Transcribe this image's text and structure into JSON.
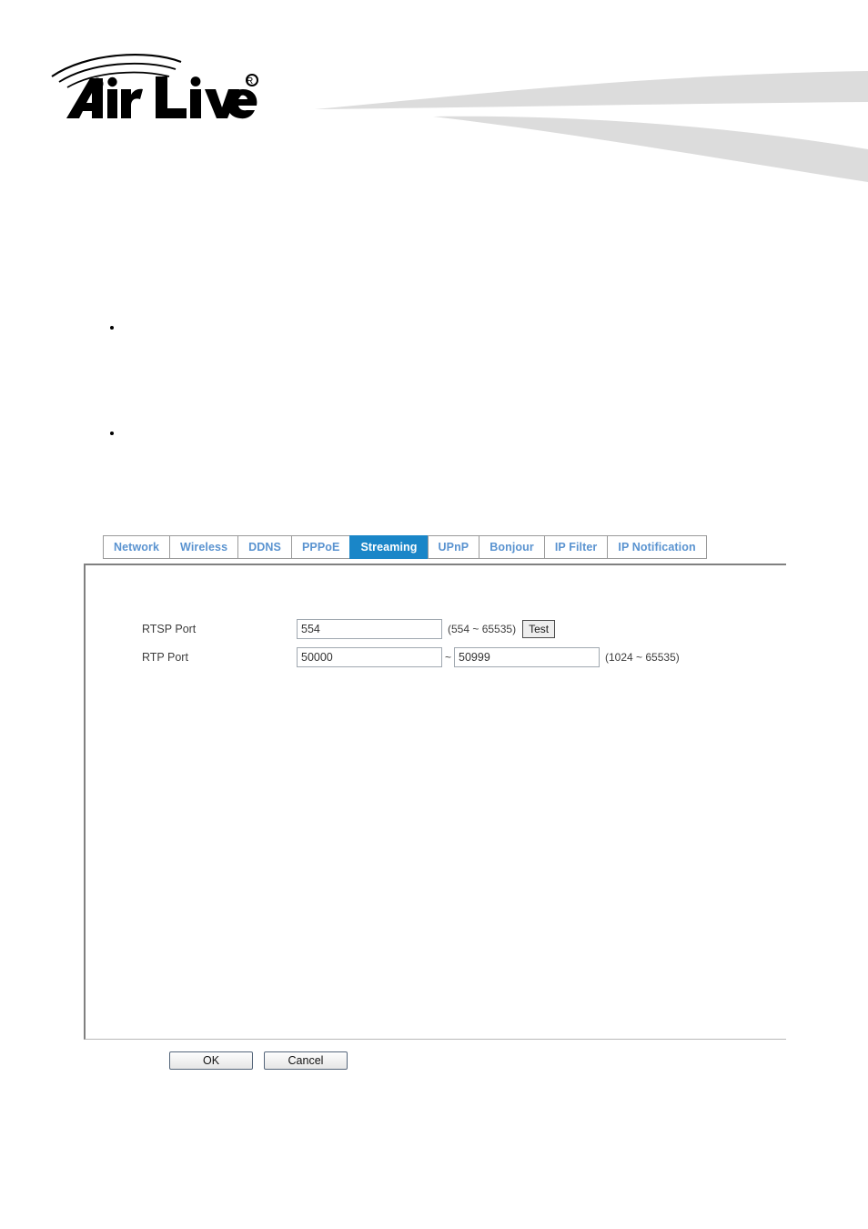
{
  "header": {
    "brand_name": "Air Live",
    "brand_trademark": "®",
    "logo_icon": "wifi-signal-arcs-icon",
    "swoosh_icon": "header-swoosh-graphic",
    "swoosh_color": "#dcdcdc"
  },
  "intro": {
    "bullets": [
      "",
      ""
    ]
  },
  "tabs": {
    "items": [
      {
        "label": "Network",
        "active": false
      },
      {
        "label": "Wireless",
        "active": false
      },
      {
        "label": "DDNS",
        "active": false
      },
      {
        "label": "PPPoE",
        "active": false
      },
      {
        "label": "Streaming",
        "active": true
      },
      {
        "label": "UPnP",
        "active": false
      },
      {
        "label": "Bonjour",
        "active": false
      },
      {
        "label": "IP Filter",
        "active": false
      },
      {
        "label": "IP Notification",
        "active": false
      }
    ],
    "active_label": "Streaming",
    "active_color": "#1a86c8",
    "inactive_color": "#5a93d0"
  },
  "form": {
    "rtsp_port": {
      "label": "RTSP Port",
      "value": "554",
      "placeholder": "",
      "range_hint": "(554 ~ 65535)",
      "test_button_label": "Test"
    },
    "rtp_port": {
      "label": "RTP Port",
      "start_value": "50000",
      "start_placeholder": "",
      "separator": "~",
      "end_value": "50999",
      "end_placeholder": "",
      "range_hint": "(1024 ~ 65535)"
    }
  },
  "footer": {
    "ok_label": "OK",
    "cancel_label": "Cancel"
  }
}
